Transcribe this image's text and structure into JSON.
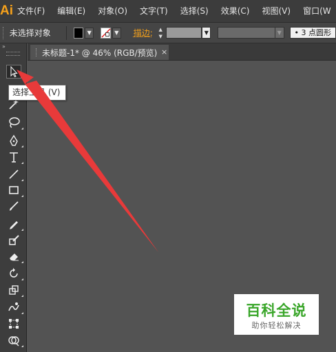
{
  "app": {
    "logo": "Ai"
  },
  "menu": [
    "文件(F)",
    "编辑(E)",
    "对象(O)",
    "文字(T)",
    "选择(S)",
    "效果(C)",
    "视图(V)",
    "窗口(W"
  ],
  "control_bar": {
    "selection_status": "未选择对象",
    "fill_color": "#000000",
    "stroke_color": "#ffffff",
    "stroke_label": "描边:",
    "stroke_weight": "",
    "brush_value": "• 3 点圆形"
  },
  "toolbar": {
    "collapse": "»",
    "tools": [
      {
        "name": "selection-tool-icon",
        "active": true
      },
      {
        "name": "magic-wand-tool-icon"
      },
      {
        "name": "lasso-tool-icon"
      },
      {
        "name": "pen-tool-icon"
      },
      {
        "name": "type-tool-icon"
      },
      {
        "name": "line-segment-tool-icon"
      },
      {
        "name": "rectangle-tool-icon"
      },
      {
        "name": "paintbrush-tool-icon"
      },
      {
        "name": "pencil-tool-icon"
      },
      {
        "name": "blob-brush-tool-icon"
      },
      {
        "name": "eraser-tool-icon"
      },
      {
        "name": "rotate-tool-icon"
      },
      {
        "name": "scale-tool-icon"
      },
      {
        "name": "warp-tool-icon"
      },
      {
        "name": "free-transform-tool-icon"
      },
      {
        "name": "shape-builder-tool-icon"
      }
    ]
  },
  "tooltip": "选择工具 (V)",
  "document_tab": {
    "title": "未标题-1* @ 46% (RGB/预览)",
    "close": "×"
  },
  "annotation": {
    "arrow_color": "#e83a3a"
  },
  "watermark": {
    "title": "百科全说",
    "subtitle": "助你轻松解决",
    "title_color": "#3aa62a"
  }
}
